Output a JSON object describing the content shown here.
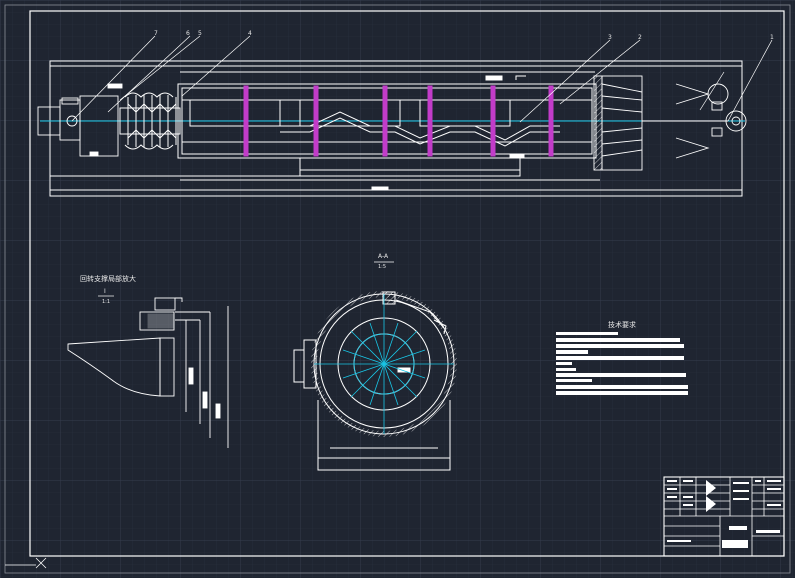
{
  "drawing": {
    "colors": {
      "background": "#1f2531",
      "grid_minor": "#2a3140",
      "grid_major": "#353d4d",
      "line": "#ffffff",
      "center_line": "#19c6e6",
      "accent": "#c23cc9",
      "dim": "#d0d0d0"
    },
    "views": {
      "section_title": "A-A",
      "section_scale": "1:5",
      "detail_title": "回转支撑局部放大",
      "detail_mark": "I",
      "detail_scale": "1:1"
    },
    "leaders": [
      "7",
      "6",
      "5",
      "4",
      "3",
      "2",
      "1"
    ],
    "notes": {
      "title": "技术要求"
    },
    "title_block": {
      "label": "title-block"
    }
  }
}
